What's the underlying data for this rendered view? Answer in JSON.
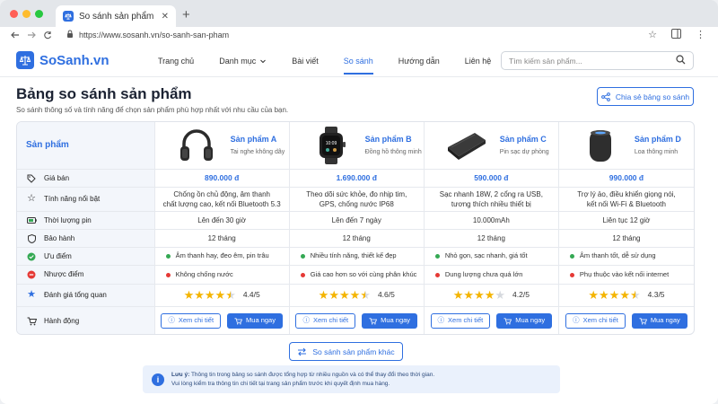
{
  "browser": {
    "tab_title": "So sánh sản phẩm",
    "tab_close": "✕",
    "new_tab": "+",
    "url": "https://www.sosanh.vn/so-sanh-san-pham"
  },
  "site": {
    "logo_text": "SoSanh.vn",
    "nav": [
      {
        "label": "Trang chủ"
      },
      {
        "label": "Danh mục"
      },
      {
        "label": "Bài viết"
      },
      {
        "label": "So sánh"
      },
      {
        "label": "Hướng dẫn"
      },
      {
        "label": "Liên hệ"
      }
    ],
    "search_placeholder": "Tìm kiếm sản phẩm..."
  },
  "page": {
    "title": "Bảng so sánh sản phẩm",
    "subtitle": "So sánh thông số và tính năng để chọn sản phẩm phù hợp nhất với nhu cầu của bạn.",
    "share_label": "Chia sẻ bảng so sánh",
    "more_label": "So sánh sản phẩm khác"
  },
  "table": {
    "header_label": "Sản phẩm",
    "products": [
      {
        "name": "Sản phẩm A",
        "desc": "Tai nghe không dây",
        "icon": "headphones"
      },
      {
        "name": "Sản phẩm B",
        "desc": "Đồng hồ thông minh",
        "icon": "smartwatch"
      },
      {
        "name": "Sản phẩm C",
        "desc": "Pin sạc dự phòng",
        "icon": "power-bank"
      },
      {
        "name": "Sản phẩm D",
        "desc": "Loa thông minh",
        "icon": "smart-speaker"
      }
    ],
    "rows": {
      "price": {
        "label": "Giá bán",
        "values": [
          "890.000 đ",
          "1.690.000 đ",
          "590.000 đ",
          "990.000 đ"
        ]
      },
      "features": {
        "label": "Tính năng nổi bật",
        "values": [
          [
            "Chống ồn chủ động, âm thanh",
            "chất lượng cao, kết nối Bluetooth 5.3"
          ],
          [
            "Theo dõi sức khỏe, đo nhịp tim,",
            "GPS, chống nước IP68"
          ],
          [
            "Sạc nhanh 18W, 2 cổng ra USB,",
            "tương thích nhiều thiết bị"
          ],
          [
            "Trợ lý ảo, điều khiển giọng nói,",
            "kết nối Wi-Fi & Bluetooth"
          ]
        ]
      },
      "battery": {
        "label": "Thời lượng pin",
        "values": [
          "Lên đến 30 giờ",
          "Lên đến 7 ngày",
          "10.000mAh",
          "Liên tục 12 giờ"
        ]
      },
      "warranty": {
        "label": "Bảo hành",
        "values": [
          "12 tháng",
          "12 tháng",
          "12 tháng",
          "12 tháng"
        ]
      },
      "pros": {
        "label": "Ưu điểm",
        "values": [
          "Âm thanh hay, đeo êm, pin trâu",
          "Nhiều tính năng, thiết kế đẹp",
          "Nhỏ gọn, sạc nhanh, giá tốt",
          "Âm thanh tốt, dễ sử dụng"
        ]
      },
      "cons": {
        "label": "Nhược điểm",
        "values": [
          "Không chống nước",
          "Giá cao hơn so với cùng phân khúc",
          "Dung lượng chưa quá lớn",
          "Phụ thuộc vào kết nối internet"
        ]
      },
      "rating": {
        "label": "Đánh giá tổng quan",
        "values": [
          4.4,
          4.6,
          4.2,
          4.3
        ],
        "texts": [
          "4.4/5",
          "4.6/5",
          "4.2/5",
          "4.3/5"
        ]
      },
      "action": {
        "label": "Hành động",
        "detail_label": "Xem chi tiết",
        "buy_label": "Mua ngay"
      }
    }
  },
  "note": {
    "bold": "Lưu ý:",
    "line1": "Thông tin trong bảng so sánh được tổng hợp từ nhiều nguồn và có thể thay đổi theo thời gian.",
    "line2": "Vui lòng kiểm tra thông tin chi tiết tại trang sản phẩm trước khi quyết định mua hàng."
  },
  "colors": {
    "accent": "#2f6fe0",
    "star": "#f4b400",
    "pro": "#34a853",
    "con": "#e53935"
  }
}
